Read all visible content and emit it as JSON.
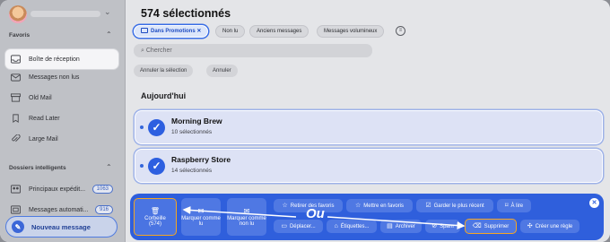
{
  "sidebar": {
    "favorites_title": "Favoris",
    "items": [
      {
        "label": "Boîte de réception",
        "icon": "inbox-icon",
        "active": true
      },
      {
        "label": "Messages non lus",
        "icon": "unread-mail-icon"
      },
      {
        "label": "Old Mail",
        "icon": "archive-box-icon"
      },
      {
        "label": "Read Later",
        "icon": "bookmark-icon"
      },
      {
        "label": "Large Mail",
        "icon": "paperclip-icon"
      }
    ],
    "smart_title": "Dossiers intelligents",
    "smart_items": [
      {
        "label": "Principaux expédit...",
        "badge": "1063",
        "icon": "people-icon"
      },
      {
        "label": "Messages automati...",
        "badge": "916",
        "icon": "robot-icon"
      }
    ],
    "new_message": "Nouveau message"
  },
  "main": {
    "title": "574 sélectionnés",
    "chips": [
      "Dans Promotions ✕",
      "Non lu",
      "Anciens messages",
      "Messages volumineux"
    ],
    "search_placeholder": "Chercher",
    "cancel_selection": "Annuler la sélection",
    "cancel": "Annuler",
    "section": "Aujourd'hui",
    "cards": [
      {
        "sender": "Morning Brew",
        "count": "10 sélectionnés"
      },
      {
        "sender": "Raspberry Store",
        "count": "14 sélectionnés"
      }
    ]
  },
  "panel": {
    "trash": "Corbeille",
    "trash_count": "(574)",
    "mark_read": "Marquer comme lu",
    "mark_unread": "Marquer comme non lu",
    "top_row": [
      "Retirer des favoris",
      "Mettre en favoris",
      "Garder le plus récent",
      "À lire"
    ],
    "bottom_row": [
      "Déplacer...",
      "Étiquettes...",
      "Archiver",
      "Spam",
      "Supprimer",
      "Créer une règle"
    ],
    "overlay_text": "Ou"
  },
  "colors": {
    "accent": "#2f5fdc",
    "highlight": "#f5a623"
  }
}
